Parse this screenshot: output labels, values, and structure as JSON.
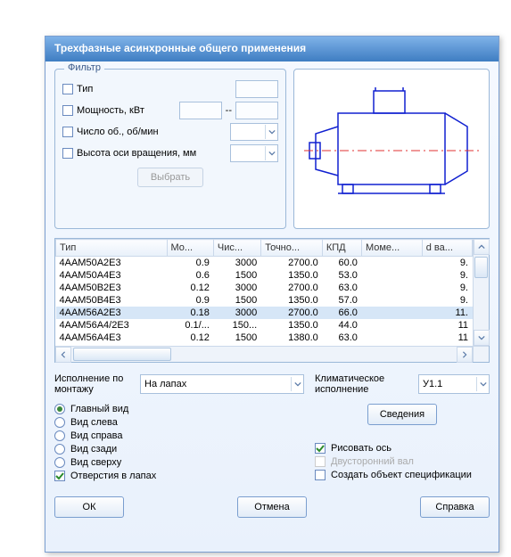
{
  "title": "Трехфазные асинхронные общего применения",
  "filter": {
    "legend": "Фильтр",
    "type_label": "Тип",
    "power_label": "Мощность, кВт",
    "power_sep": "--",
    "rpm_label": "Число об., об/мин",
    "height_label": "Высота оси вращения, мм",
    "select_button": "Выбрать"
  },
  "table": {
    "headers": [
      "Тип",
      "Мо...",
      "Чис...",
      "Точно...",
      "КПД",
      "Моме...",
      "d ва..."
    ],
    "rows": [
      {
        "c": [
          "4ААМ50А2Е3",
          "0.9",
          "3000",
          "2700.0",
          "60.0",
          "",
          "9."
        ]
      },
      {
        "c": [
          "4ААМ50А4Е3",
          "0.6",
          "1500",
          "1350.0",
          "53.0",
          "",
          "9."
        ]
      },
      {
        "c": [
          "4ААМ50В2Е3",
          "0.12",
          "3000",
          "2700.0",
          "63.0",
          "",
          "9."
        ]
      },
      {
        "c": [
          "4ААМ50В4Е3",
          "0.9",
          "1500",
          "1350.0",
          "57.0",
          "",
          "9."
        ]
      },
      {
        "c": [
          "4ААМ56А2Е3",
          "0.18",
          "3000",
          "2700.0",
          "66.0",
          "",
          "11."
        ],
        "sel": true
      },
      {
        "c": [
          "4ААМ56А4/2Е3",
          "0.1/...",
          "150...",
          "1350.0",
          "44.0",
          "",
          "11"
        ]
      },
      {
        "c": [
          "4ААМ56А4Е3",
          "0.12",
          "1500",
          "1380.0",
          "63.0",
          "",
          "11"
        ]
      }
    ]
  },
  "mount": {
    "label": "Исполнение по монтажу",
    "value": "На лапах"
  },
  "climate": {
    "label": "Климатическое исполнение",
    "value": "У1.1"
  },
  "info_button": "Сведения",
  "views": {
    "main": "Главный вид",
    "left": "Вид слева",
    "right": "Вид справа",
    "back": "Вид сзади",
    "top": "Вид сверху",
    "holes": "Отверстия в лапах"
  },
  "options": {
    "draw_axis": "Рисовать ось",
    "two_sided": "Двусторонний вал",
    "create_spec": "Создать объект спецификации"
  },
  "buttons": {
    "ok": "ОК",
    "cancel": "Отмена",
    "help": "Справка"
  }
}
